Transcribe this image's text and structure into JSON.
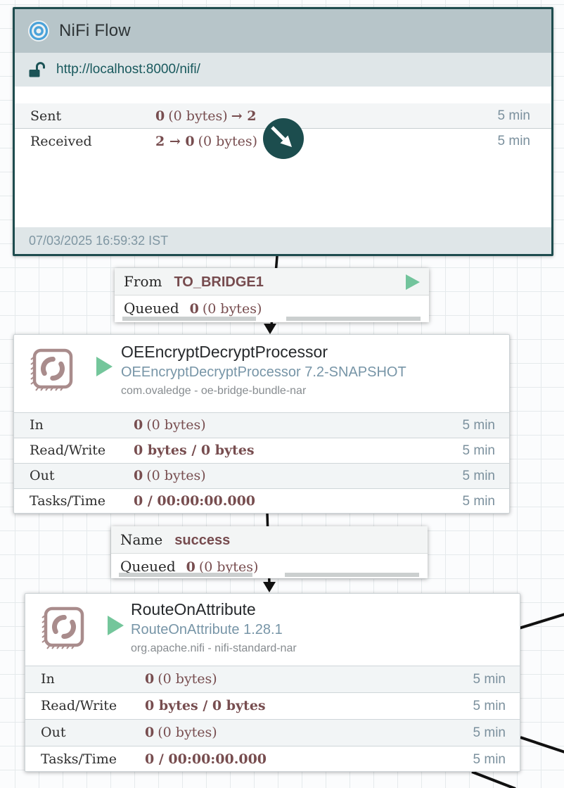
{
  "process_group": {
    "title": "NiFi Flow",
    "url": "http://localhost:8000/nifi/",
    "stats": [
      {
        "label": "Sent",
        "bold_head": "0",
        "regular": "(0 bytes)",
        "bold_tail": "→ 2",
        "window": "5 min"
      },
      {
        "label": "Received",
        "bold_head": "2 → 0",
        "regular": "(0 bytes)",
        "bold_tail": "",
        "window": "5 min"
      }
    ],
    "timestamp": "07/03/2025 16:59:32 IST"
  },
  "connections": [
    {
      "key": "From",
      "name": "TO_BRIDGE1",
      "queued_label": "Queued",
      "queued_count": "0",
      "queued_size": "(0 bytes)"
    },
    {
      "key": "Name",
      "name": "success",
      "queued_label": "Queued",
      "queued_count": "0",
      "queued_size": "(0 bytes)"
    }
  ],
  "processors": [
    {
      "name": "OEEncryptDecryptProcessor",
      "type": "OEEncryptDecryptProcessor 7.2-SNAPSHOT",
      "bundle": "com.ovaledge - oe-bridge-bundle-nar",
      "stats": [
        {
          "label": "In",
          "bold": "0",
          "regular": "(0 bytes)",
          "window": "5 min"
        },
        {
          "label": "Read/Write",
          "bold": "0 bytes / 0 bytes",
          "regular": "",
          "window": "5 min"
        },
        {
          "label": "Out",
          "bold": "0",
          "regular": "(0 bytes)",
          "window": "5 min"
        },
        {
          "label": "Tasks/Time",
          "bold": "0 / 00:00:00.000",
          "regular": "",
          "window": "5 min"
        }
      ]
    },
    {
      "name": "RouteOnAttribute",
      "type": "RouteOnAttribute 1.28.1",
      "bundle": "org.apache.nifi - nifi-standard-nar",
      "stats": [
        {
          "label": "In",
          "bold": "0",
          "regular": "(0 bytes)",
          "window": "5 min"
        },
        {
          "label": "Read/Write",
          "bold": "0 bytes / 0 bytes",
          "regular": "",
          "window": "5 min"
        },
        {
          "label": "Out",
          "bold": "0",
          "regular": "(0 bytes)",
          "window": "5 min"
        },
        {
          "label": "Tasks/Time",
          "bold": "0 / 00:00:00.000",
          "regular": "",
          "window": "5 min"
        }
      ]
    }
  ],
  "icons": {
    "group": "bullseye-icon",
    "url_lock": "unlocked-padlock-icon",
    "processor": "chip-sync-icon",
    "run_status": "play-icon",
    "drill_in": "arrow-down-right-badge"
  },
  "colors": {
    "group_border": "#1e4c4e",
    "group_header_bg": "#b7c5c9",
    "group_subheader_bg": "#dfe6e8",
    "stat_value": "#774d4f",
    "stat_window": "#7b909d",
    "running_green": "#72c49c",
    "type_slate": "#7795a7",
    "processor_icon": "#a98c8c",
    "url_teal": "#19595d",
    "connection_line": "#111111",
    "badge_teal": "#1c4d4e"
  }
}
